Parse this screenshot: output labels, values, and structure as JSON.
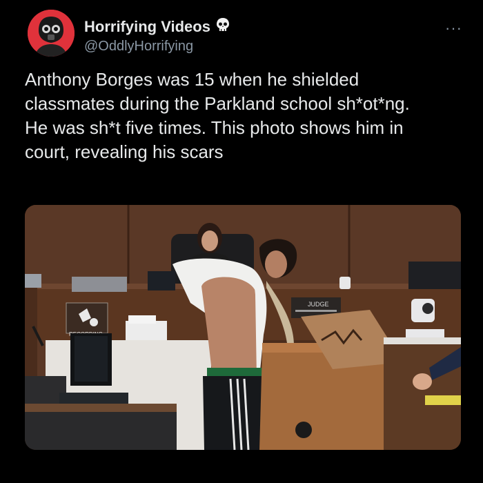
{
  "author": {
    "display_name": "Horrifying Videos",
    "handle": "@OddlyHorrifying",
    "badge_icon": "skull-icon",
    "avatar_bg": "#e0323b"
  },
  "tweet": {
    "text": "Anthony Borges was 15 when he shielded\nclassmates during the Parkland school sh*ot*ng.\nHe was sh*t five times. This photo shows him in\ncourt, revealing his scars"
  },
  "menu": {
    "more_label": "···"
  },
  "media": {
    "judge_label": "JUDGE",
    "recording_label": "RECORDING"
  }
}
